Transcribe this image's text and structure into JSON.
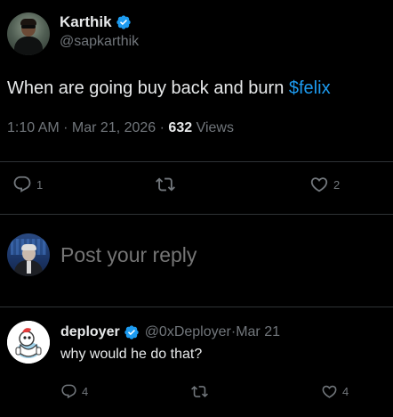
{
  "tweet": {
    "author": {
      "display_name": "Karthik",
      "handle": "@sapkarthik",
      "verified": true,
      "verified_color": "#1d9bf0"
    },
    "text_before": "When are going buy back and burn ",
    "cashtag": "$felix",
    "time": "1:10 AM",
    "separator": " · ",
    "date": "Mar 21, 2026",
    "views_count": "632",
    "views_label": " Views",
    "actions": {
      "reply_icon": "reply-icon",
      "reply_count": "1",
      "retweet_icon": "retweet-icon",
      "like_icon": "heart-icon",
      "like_count": "2"
    }
  },
  "composer": {
    "placeholder": "Post your reply"
  },
  "reply": {
    "author": {
      "display_name": "deployer",
      "handle": "@0xDeployer",
      "verified": true
    },
    "date": "Mar 21",
    "text": "why would he do that?",
    "actions": {
      "reply_icon": "reply-icon",
      "reply_count": "4",
      "retweet_icon": "retweet-icon",
      "like_icon": "heart-icon",
      "like_count": "4"
    }
  },
  "colors": {
    "background": "#000000",
    "text_primary": "#e7e9ea",
    "text_secondary": "#71767b",
    "accent": "#1d9bf0",
    "divider": "#2f3336"
  }
}
